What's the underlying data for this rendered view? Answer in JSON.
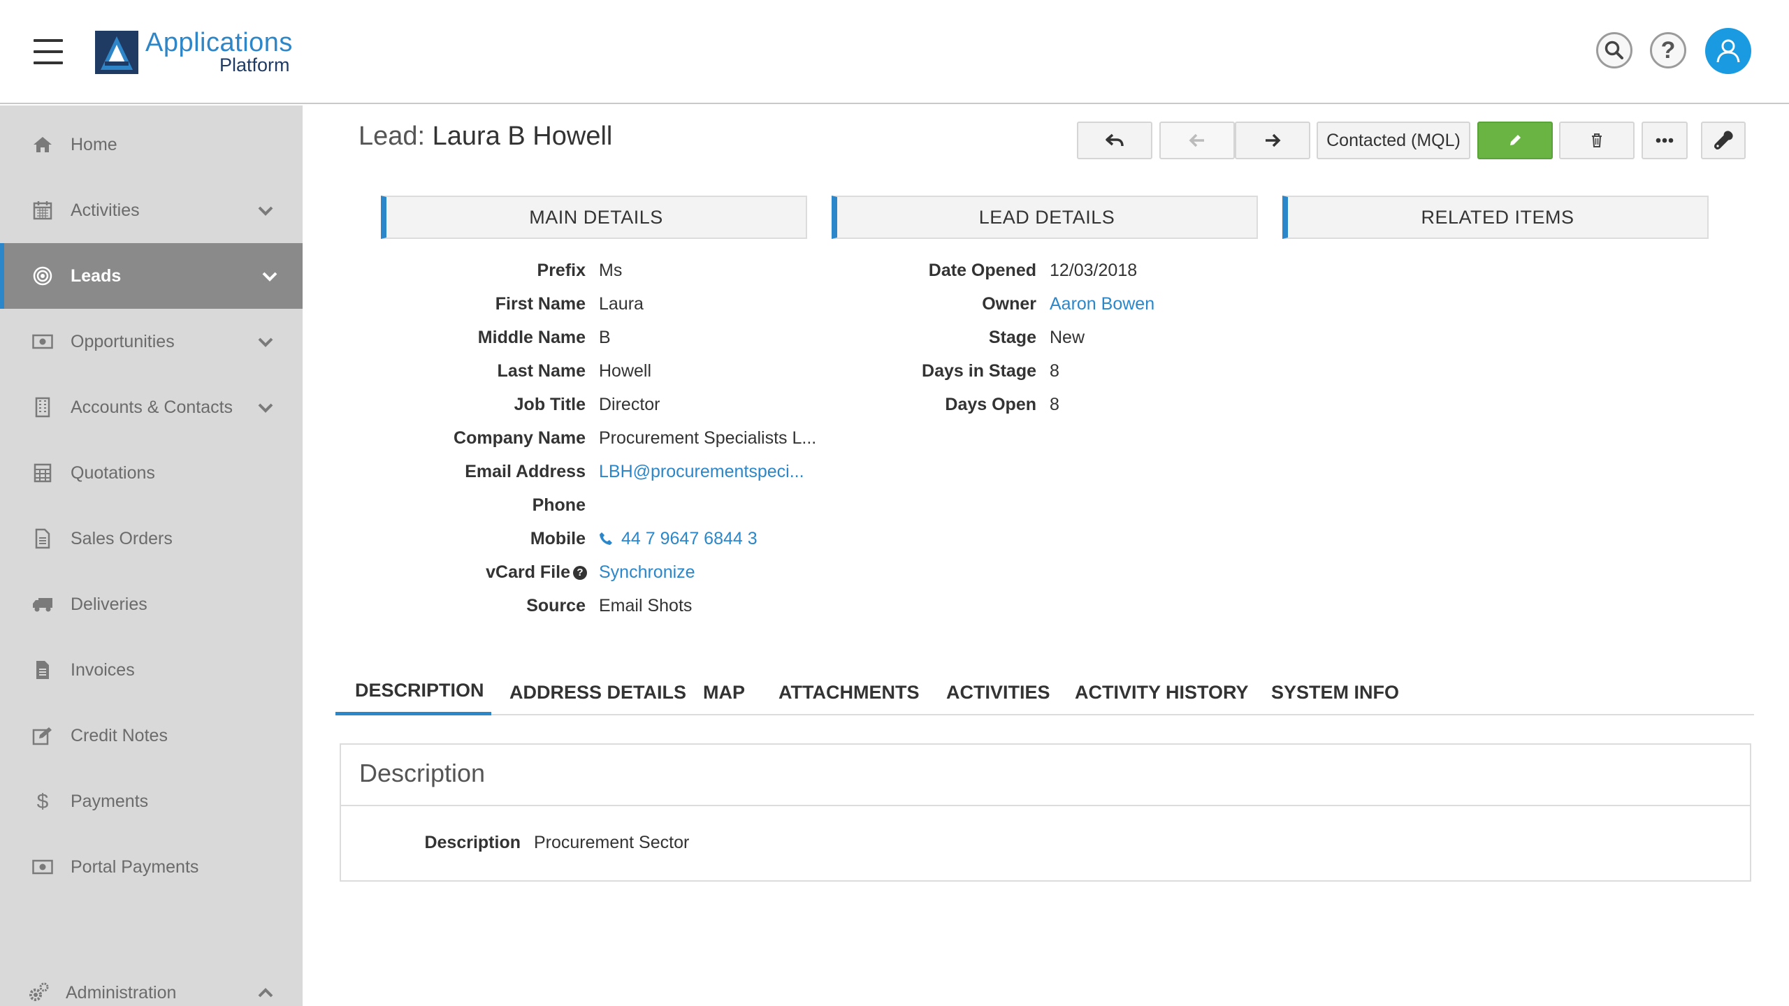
{
  "brand": {
    "line1": "Applications",
    "line2": "Platform"
  },
  "header": {
    "help_glyph": "?"
  },
  "sidebar": {
    "items": [
      {
        "label": "Home",
        "icon": "home-icon",
        "has_chevron": false,
        "active": false
      },
      {
        "label": "Activities",
        "icon": "calendar-icon",
        "has_chevron": true,
        "active": false
      },
      {
        "label": "Leads",
        "icon": "target-icon",
        "has_chevron": true,
        "active": true
      },
      {
        "label": "Opportunities",
        "icon": "money-icon",
        "has_chevron": true,
        "active": false
      },
      {
        "label": "Accounts & Contacts",
        "icon": "building-icon",
        "has_chevron": true,
        "active": false
      },
      {
        "label": "Quotations",
        "icon": "calculator-icon",
        "has_chevron": false,
        "active": false
      },
      {
        "label": "Sales Orders",
        "icon": "document-icon",
        "has_chevron": false,
        "active": false
      },
      {
        "label": "Deliveries",
        "icon": "truck-icon",
        "has_chevron": false,
        "active": false
      },
      {
        "label": "Invoices",
        "icon": "invoice-icon",
        "has_chevron": false,
        "active": false
      },
      {
        "label": "Credit Notes",
        "icon": "edit-icon",
        "has_chevron": false,
        "active": false
      },
      {
        "label": "Payments",
        "icon": "dollar-icon",
        "has_chevron": false,
        "active": false
      },
      {
        "label": "Portal Payments",
        "icon": "money-icon",
        "has_chevron": false,
        "active": false
      }
    ],
    "admin": {
      "label": "Administration",
      "icon": "gears-icon"
    }
  },
  "page": {
    "title_prefix": "Lead:",
    "title_name": "Laura B Howell"
  },
  "toolbar": {
    "status_label": "Contacted (MQL)"
  },
  "sections": {
    "main": "MAIN DETAILS",
    "lead": "LEAD DETAILS",
    "related": "RELATED ITEMS"
  },
  "main_details": [
    {
      "label": "Prefix",
      "value": "Ms",
      "link": false
    },
    {
      "label": "First Name",
      "value": "Laura",
      "link": false
    },
    {
      "label": "Middle Name",
      "value": "B",
      "link": false
    },
    {
      "label": "Last Name",
      "value": "Howell",
      "link": false
    },
    {
      "label": "Job Title",
      "value": "Director",
      "link": false
    },
    {
      "label": "Company Name",
      "value": "Procurement Specialists L...",
      "link": false
    },
    {
      "label": "Email Address",
      "value": "LBH@procurementspeci...",
      "link": true
    },
    {
      "label": "Phone",
      "value": "",
      "link": false
    },
    {
      "label": "Mobile",
      "value": "44 7 9647 6844 3",
      "link": true
    },
    {
      "label": "vCard File",
      "value": "Synchronize",
      "link": true
    },
    {
      "label": "Source",
      "value": "Email Shots",
      "link": false
    }
  ],
  "lead_details": [
    {
      "label": "Date Opened",
      "value": "12/03/2018",
      "link": false
    },
    {
      "label": "Owner",
      "value": "Aaron Bowen",
      "link": true
    },
    {
      "label": "Stage",
      "value": "New",
      "link": false
    },
    {
      "label": "Days in Stage",
      "value": "8",
      "link": false
    },
    {
      "label": "Days Open",
      "value": "8",
      "link": false
    }
  ],
  "tabs": [
    "DESCRIPTION",
    "ADDRESS DETAILS",
    "MAP",
    "ATTACHMENTS",
    "ACTIVITIES",
    "ACTIVITY HISTORY",
    "SYSTEM INFO"
  ],
  "description": {
    "title": "Description",
    "label": "Description",
    "value": "Procurement Sector"
  },
  "colors": {
    "accent": "#2b87c9",
    "green": "#6ab443",
    "sidebar_bg": "#d9d9d9",
    "active_bg": "#8a8a8a",
    "avatar": "#1a9ae0"
  }
}
